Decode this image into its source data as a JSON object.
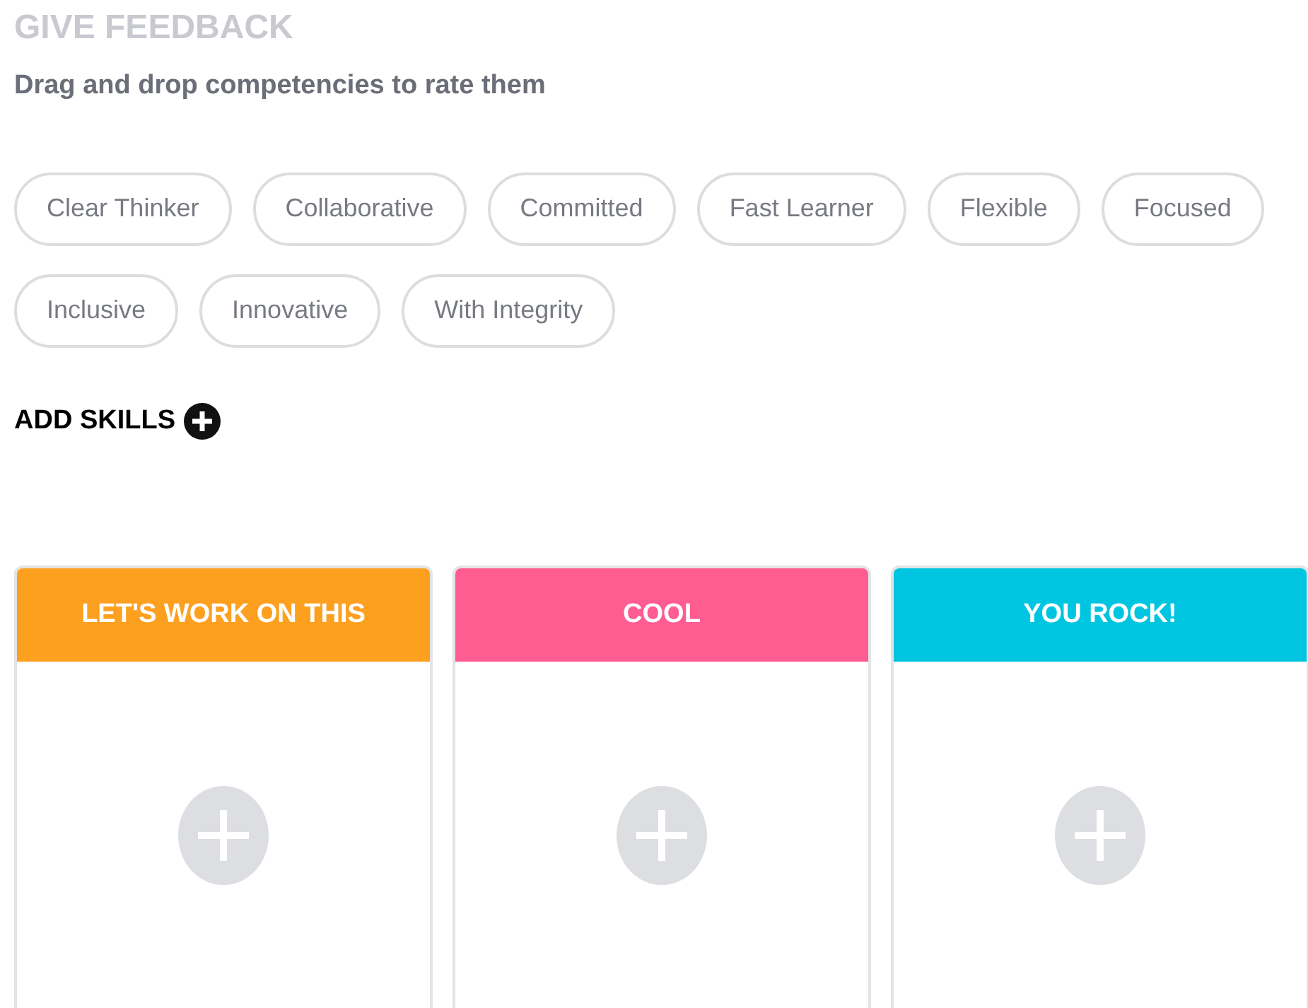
{
  "header": {
    "title": "GIVE FEEDBACK",
    "subtitle": "Drag and drop competencies to rate them"
  },
  "skills": [
    {
      "label": "Clear Thinker"
    },
    {
      "label": "Collaborative"
    },
    {
      "label": "Committed"
    },
    {
      "label": "Fast Learner"
    },
    {
      "label": "Flexible"
    },
    {
      "label": "Focused"
    },
    {
      "label": "Inclusive"
    },
    {
      "label": "Innovative"
    },
    {
      "label": "With Integrity"
    }
  ],
  "add_skills": {
    "label": "ADD SKILLS"
  },
  "columns": [
    {
      "title": "LET'S WORK ON THIS",
      "color": "#fda01f"
    },
    {
      "title": "COOL",
      "color": "#ff5c92"
    },
    {
      "title": "YOU ROCK!",
      "color": "#00c5e0"
    }
  ]
}
